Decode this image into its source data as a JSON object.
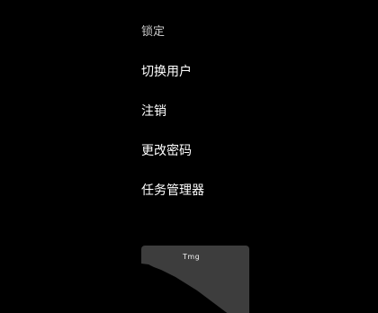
{
  "security_menu": {
    "items": [
      {
        "label": "锁定"
      },
      {
        "label": "切换用户"
      },
      {
        "label": "注销"
      },
      {
        "label": "更改密码"
      },
      {
        "label": "任务管理器"
      }
    ]
  },
  "preview_tile": {
    "label": "Tmg",
    "background_color": "#3d3d3d"
  }
}
